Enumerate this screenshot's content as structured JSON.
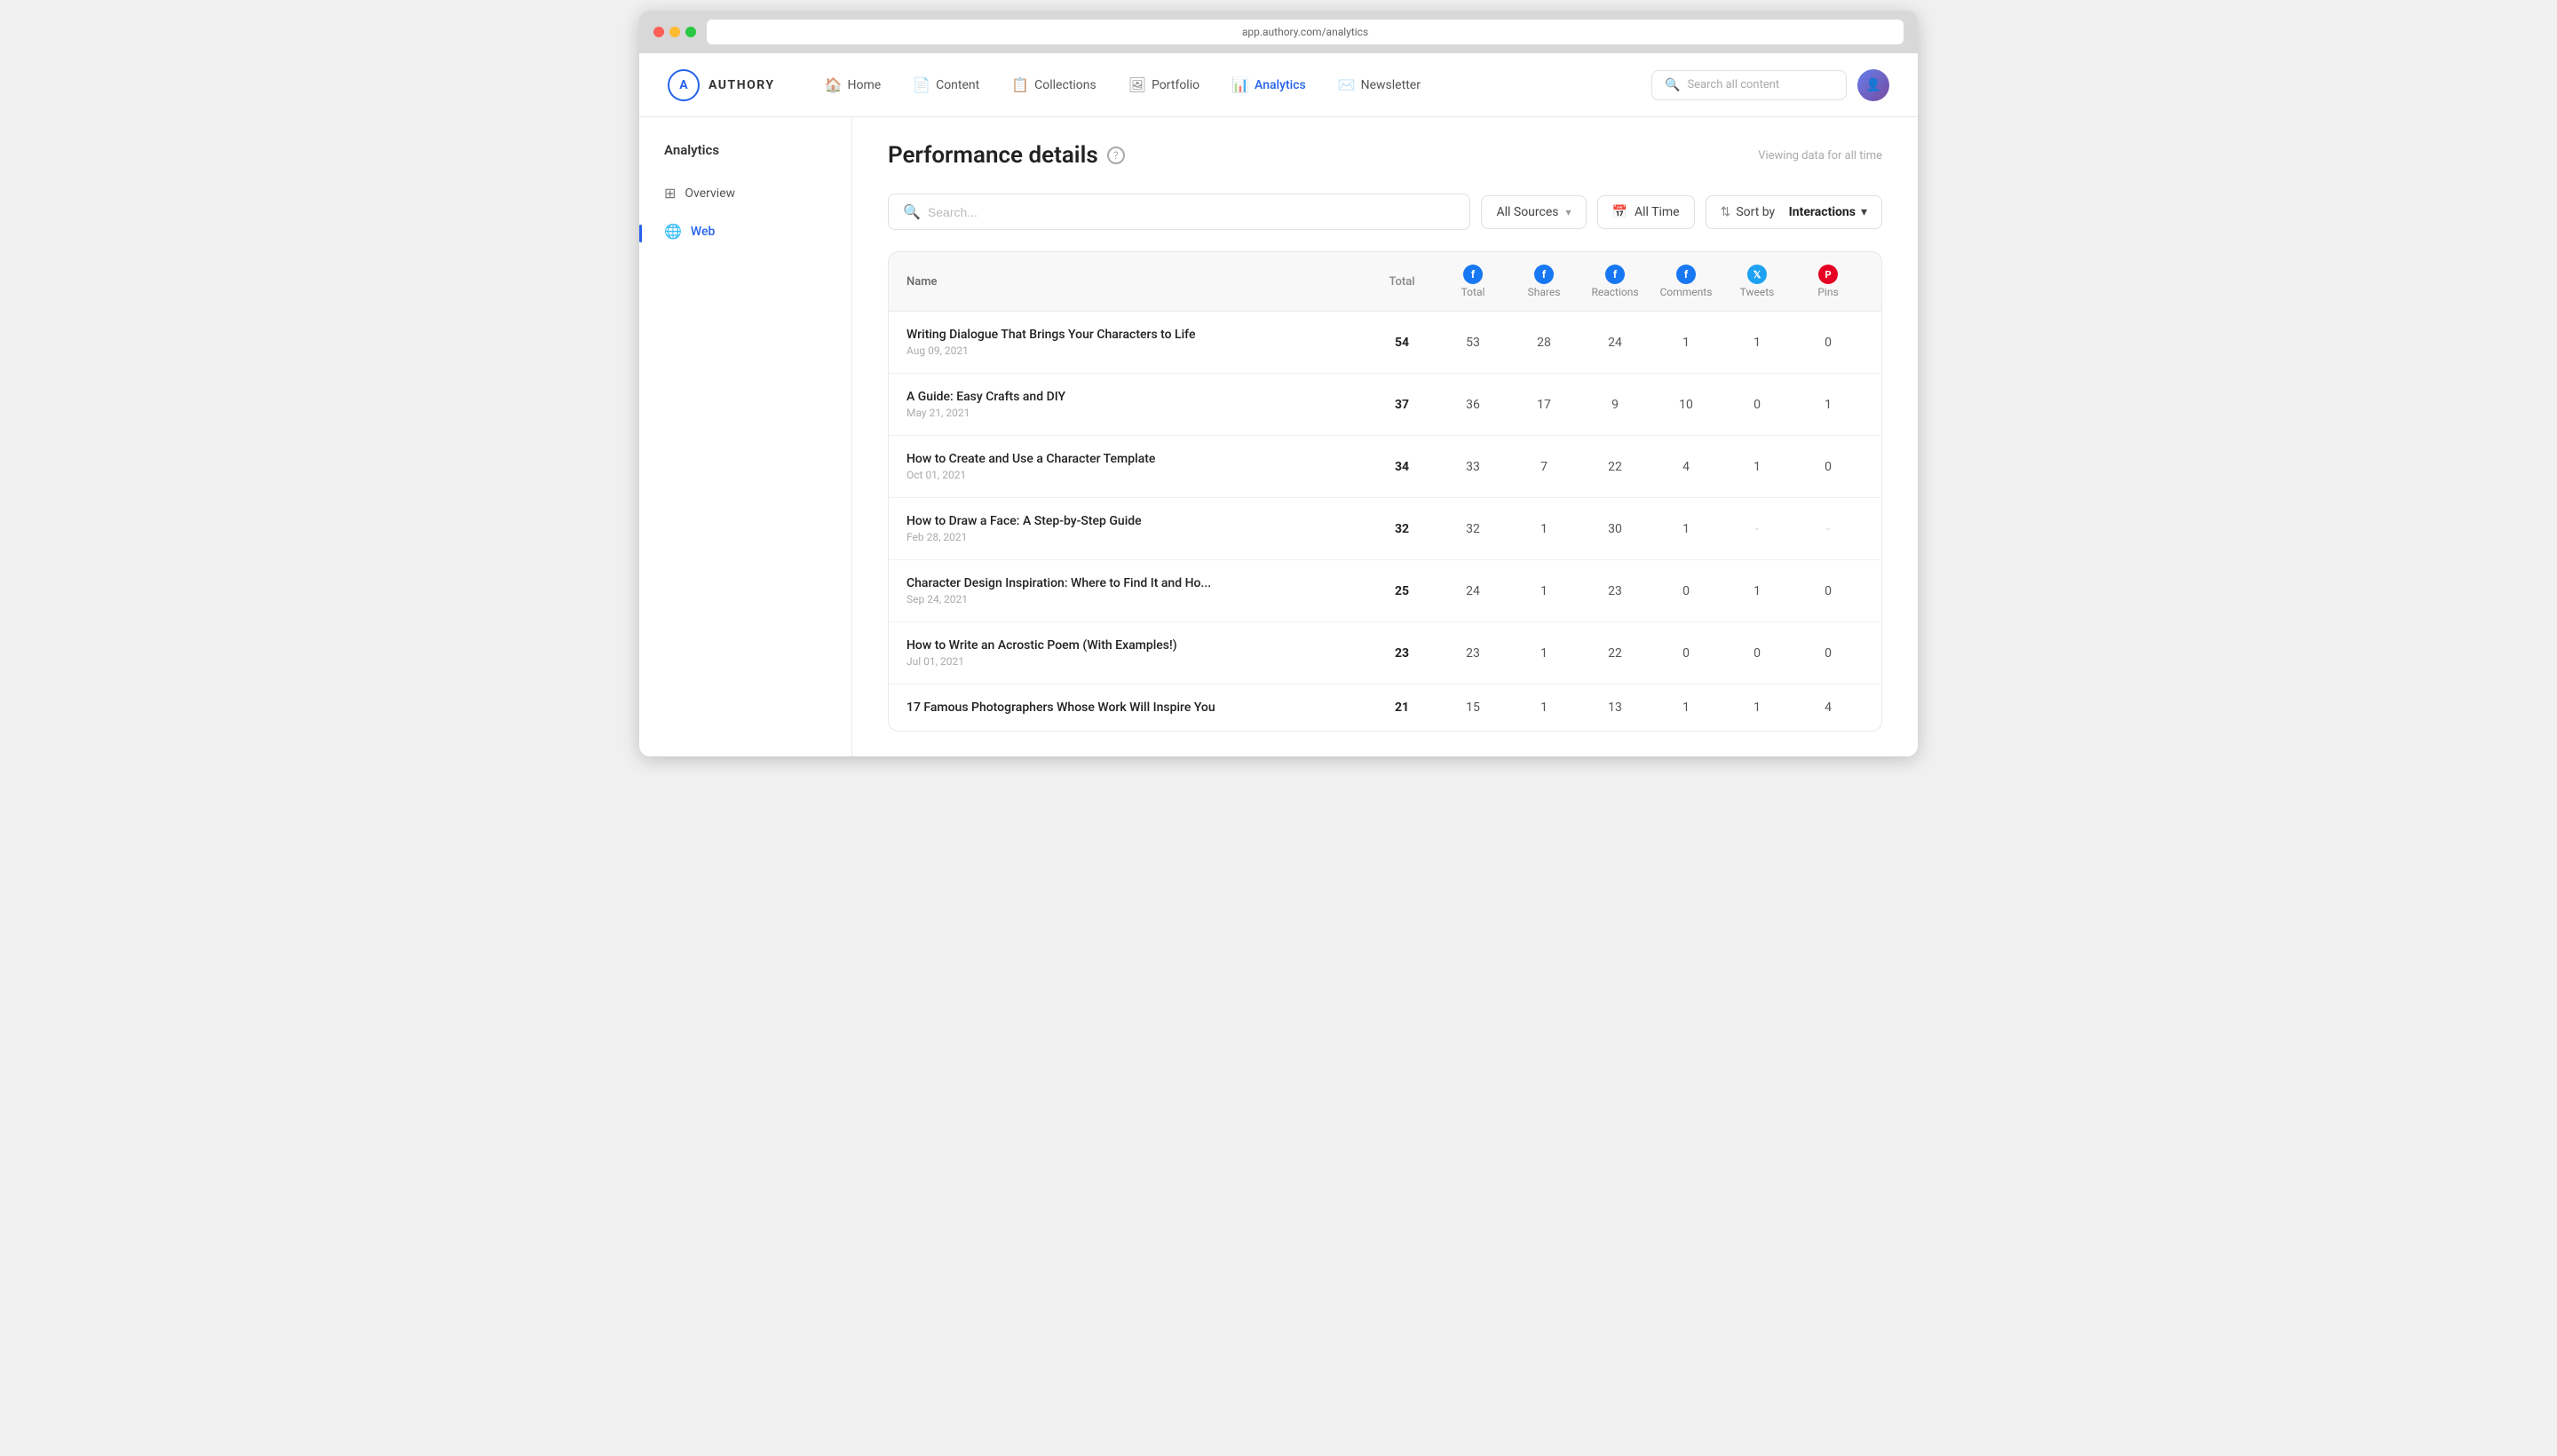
{
  "browser": {
    "address": "app.authory.com/analytics"
  },
  "app": {
    "logo_letter": "A",
    "logo_text": "AUTHORY"
  },
  "nav": {
    "links": [
      {
        "id": "home",
        "label": "Home",
        "icon": "🏠",
        "active": false
      },
      {
        "id": "content",
        "label": "Content",
        "icon": "📄",
        "active": false
      },
      {
        "id": "collections",
        "label": "Collections",
        "icon": "📋",
        "active": false
      },
      {
        "id": "portfolio",
        "label": "Portfolio",
        "icon": "🖼",
        "active": false
      },
      {
        "id": "analytics",
        "label": "Analytics",
        "icon": "📊",
        "active": true
      },
      {
        "id": "newsletter",
        "label": "Newsletter",
        "icon": "✉️",
        "active": false
      }
    ],
    "search_placeholder": "Search all content"
  },
  "sidebar": {
    "title": "Analytics",
    "items": [
      {
        "id": "overview",
        "label": "Overview",
        "icon": "⊞",
        "active": false
      },
      {
        "id": "web",
        "label": "Web",
        "icon": "🌐",
        "active": true
      }
    ]
  },
  "page": {
    "title": "Performance details",
    "viewing_label": "Viewing data for all time",
    "help_tooltip": "?"
  },
  "filters": {
    "search_placeholder": "Search...",
    "sources_label": "All Sources",
    "time_label": "All Time",
    "sort_prefix": "Sort by",
    "sort_value": "Interactions"
  },
  "table": {
    "columns": [
      {
        "id": "name",
        "label": "Name",
        "type": "text"
      },
      {
        "id": "total",
        "label": "Total",
        "type": "text"
      },
      {
        "id": "fb_total",
        "label": "Total",
        "type": "facebook"
      },
      {
        "id": "fb_shares",
        "label": "Shares",
        "type": "facebook"
      },
      {
        "id": "fb_reactions",
        "label": "Reactions",
        "type": "facebook"
      },
      {
        "id": "fb_comments",
        "label": "Comments",
        "type": "facebook"
      },
      {
        "id": "tw_tweets",
        "label": "Tweets",
        "type": "twitter"
      },
      {
        "id": "pi_pins",
        "label": "Pins",
        "type": "pinterest"
      }
    ],
    "rows": [
      {
        "title": "Writing Dialogue That Brings Your Characters to Life",
        "date": "Aug 09, 2021",
        "total": "54",
        "fb_total": "53",
        "fb_shares": "28",
        "fb_reactions": "24",
        "fb_comments": "1",
        "tw_tweets": "1",
        "pi_pins": "0"
      },
      {
        "title": "A Guide: Easy Crafts and DIY",
        "date": "May 21, 2021",
        "total": "37",
        "fb_total": "36",
        "fb_shares": "17",
        "fb_reactions": "9",
        "fb_comments": "10",
        "tw_tweets": "0",
        "pi_pins": "1"
      },
      {
        "title": "How to Create and Use a Character Template",
        "date": "Oct 01, 2021",
        "total": "34",
        "fb_total": "33",
        "fb_shares": "7",
        "fb_reactions": "22",
        "fb_comments": "4",
        "tw_tweets": "1",
        "pi_pins": "0"
      },
      {
        "title": "How to Draw a Face: A Step-by-Step Guide",
        "date": "Feb 28, 2021",
        "total": "32",
        "fb_total": "32",
        "fb_shares": "1",
        "fb_reactions": "30",
        "fb_comments": "1",
        "tw_tweets": "-",
        "pi_pins": "-"
      },
      {
        "title": "Character Design Inspiration: Where to Find It and Ho...",
        "date": "Sep 24, 2021",
        "total": "25",
        "fb_total": "24",
        "fb_shares": "1",
        "fb_reactions": "23",
        "fb_comments": "0",
        "tw_tweets": "1",
        "pi_pins": "0"
      },
      {
        "title": "How to Write an Acrostic Poem (With Examples!)",
        "date": "Jul 01, 2021",
        "total": "23",
        "fb_total": "23",
        "fb_shares": "1",
        "fb_reactions": "22",
        "fb_comments": "0",
        "tw_tweets": "0",
        "pi_pins": "0"
      },
      {
        "title": "17 Famous Photographers Whose Work Will Inspire You",
        "date": "",
        "total": "21",
        "fb_total": "15",
        "fb_shares": "1",
        "fb_reactions": "13",
        "fb_comments": "1",
        "tw_tweets": "1",
        "pi_pins": "4"
      }
    ]
  }
}
